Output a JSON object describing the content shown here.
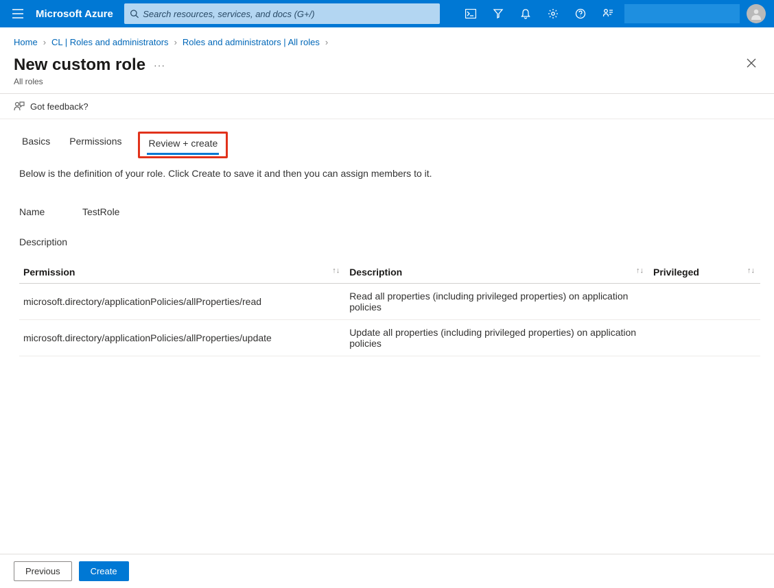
{
  "brand": "Microsoft Azure",
  "search": {
    "placeholder": "Search resources, services, and docs (G+/)"
  },
  "breadcrumb": {
    "items": [
      {
        "label": "Home"
      },
      {
        "label": "CL | Roles and administrators"
      },
      {
        "label": "Roles and administrators | All roles"
      }
    ]
  },
  "page": {
    "title": "New custom role",
    "subtitle": "All roles",
    "feedback": "Got feedback?",
    "helper": "Below is the definition of your role. Click Create to save it and then you can assign members to it.",
    "name_label": "Name",
    "name_value": "TestRole",
    "description_label": "Description",
    "description_value": ""
  },
  "tabs": {
    "items": [
      {
        "label": "Basics",
        "active": false
      },
      {
        "label": "Permissions",
        "active": false
      },
      {
        "label": "Review + create",
        "active": true
      }
    ]
  },
  "table": {
    "columns": {
      "permission": "Permission",
      "description": "Description",
      "privileged": "Privileged"
    },
    "rows": [
      {
        "permission": "microsoft.directory/applicationPolicies/allProperties/read",
        "description": "Read all properties (including privileged properties) on application policies",
        "privileged": ""
      },
      {
        "permission": "microsoft.directory/applicationPolicies/allProperties/update",
        "description": "Update all properties (including privileged properties) on application policies",
        "privileged": ""
      }
    ]
  },
  "footer": {
    "previous": "Previous",
    "create": "Create"
  }
}
